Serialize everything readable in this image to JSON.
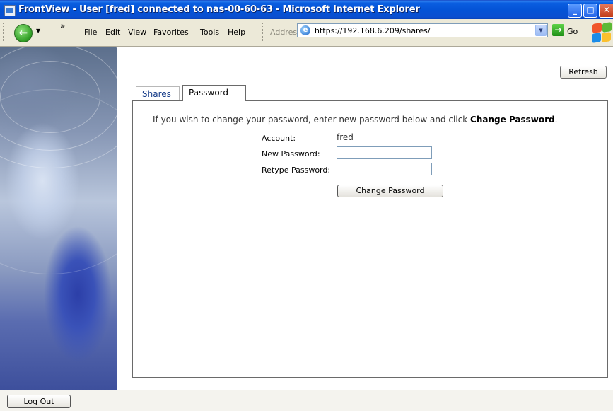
{
  "window": {
    "title": "FrontView - User [fred] connected to nas-00-60-63 - Microsoft Internet Explorer",
    "min_glyph": "_",
    "max_glyph": "□",
    "close_glyph": "✕"
  },
  "toolbar": {
    "back_glyph": "←",
    "dropdown_glyph": "▼",
    "chevron": "»",
    "menu": [
      "File",
      "Edit",
      "View",
      "Favorites",
      "Tools",
      "Help"
    ],
    "address_label": "Address",
    "address_url": "https://192.168.6.209/shares/",
    "go_label": "Go",
    "go_glyph": "→",
    "ie_glyph": "e"
  },
  "page": {
    "refresh_label": "Refresh",
    "tabs": [
      {
        "label": "Shares",
        "active": false
      },
      {
        "label": "Password",
        "active": true
      }
    ],
    "intro_text": "If you wish to change your password, enter new password below and click ",
    "intro_bold": "Change Password",
    "intro_end": ".",
    "account_label": "Account:",
    "account_value": "fred",
    "new_password_label": "New Password:",
    "new_password_value": "",
    "retype_password_label": "Retype Password:",
    "retype_password_value": "",
    "change_button_label": "Change Password",
    "logout_label": "Log Out"
  },
  "colors": {
    "titlebar": "#0453d6",
    "chrome": "#ece9d8",
    "tab_link": "#1a3f8a"
  }
}
